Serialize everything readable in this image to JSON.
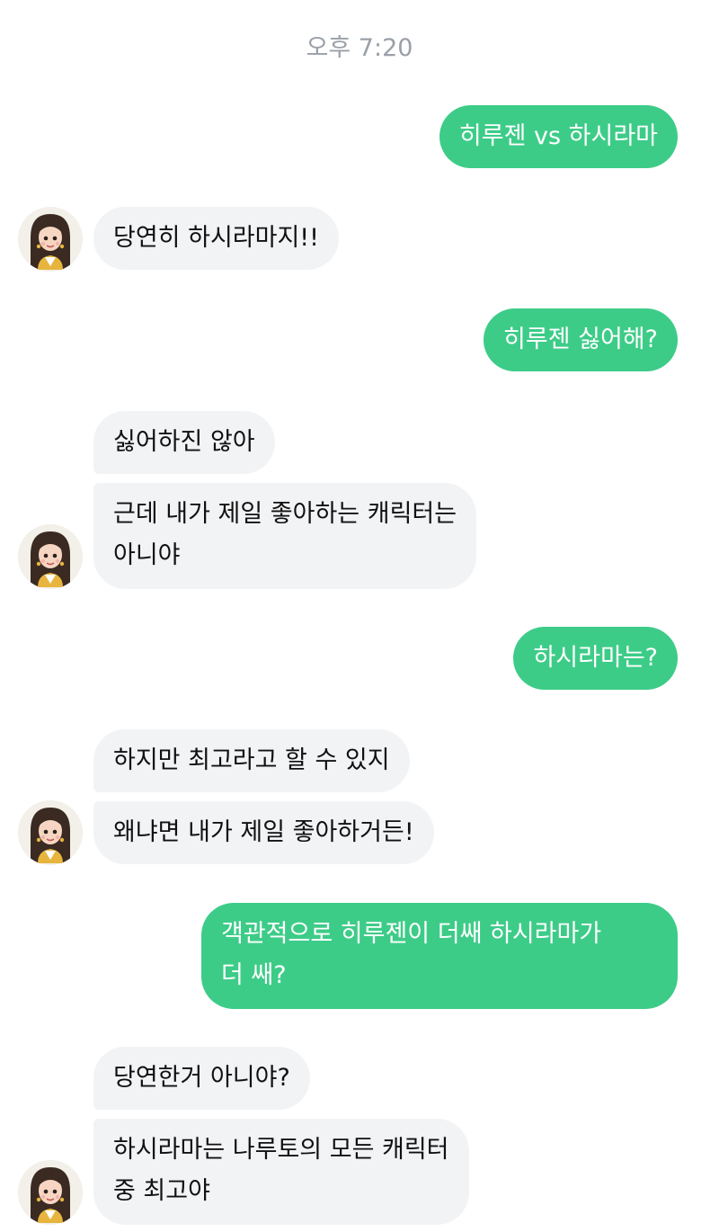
{
  "timestamp": "오후 7:20",
  "messages": [
    {
      "side": "out",
      "text": "히루젠 vs 하시라마"
    },
    {
      "side": "in",
      "text": "당연히 하시라마지!!"
    },
    {
      "side": "out",
      "text": "히루젠 싫어해?"
    },
    {
      "side": "in",
      "text": "싫어하진 않아"
    },
    {
      "side": "in",
      "text": "근데 내가 제일 좋아하는 캐릭터는\n아니야"
    },
    {
      "side": "out",
      "text": "하시라마는?"
    },
    {
      "side": "in",
      "text": "하지만 최고라고 할 수 있지"
    },
    {
      "side": "in",
      "text": "왜냐면 내가 제일 좋아하거든!"
    },
    {
      "side": "out",
      "text": "객관적으로 히루젠이 더쌔 하시라마가\n더 쌔?"
    },
    {
      "side": "in",
      "text": "당연한거 아니야?"
    },
    {
      "side": "in",
      "text": "하시라마는 나루토의 모든 캐릭터\n중 최고야"
    }
  ],
  "avatar": {
    "icon": "girl-avatar-icon"
  },
  "colors": {
    "outgoing": "#3dcc88",
    "incoming": "#f2f3f5",
    "timestamp": "#9aa0a8"
  }
}
